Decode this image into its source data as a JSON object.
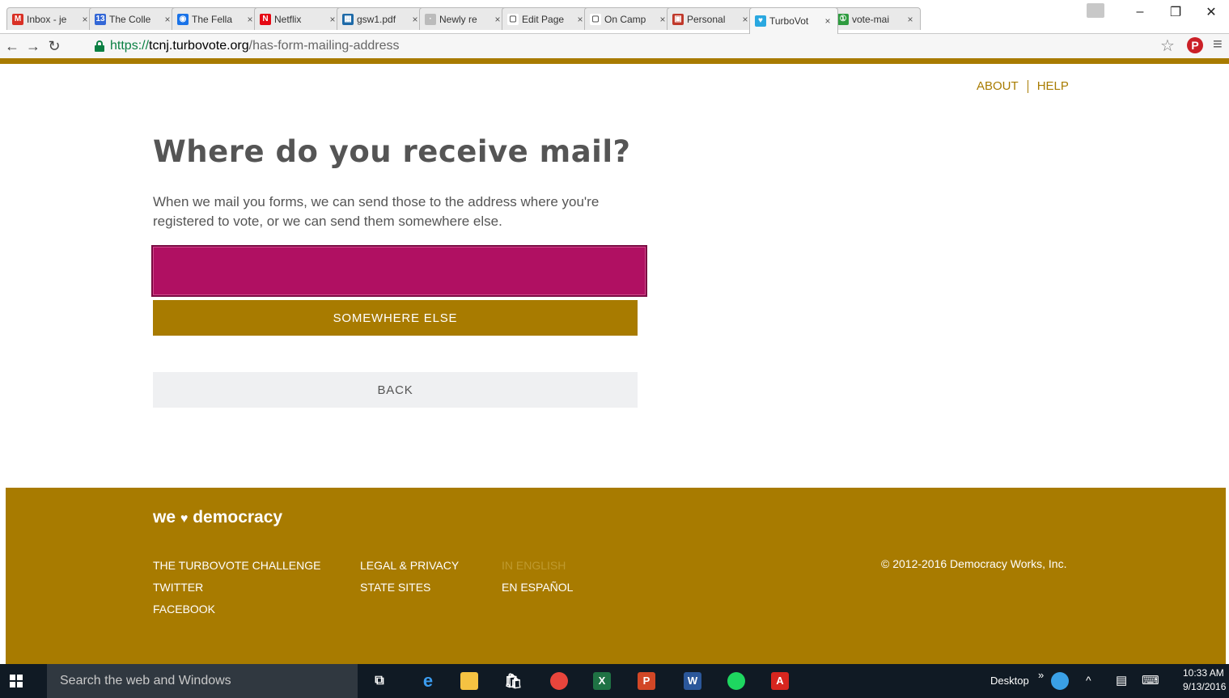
{
  "browser": {
    "tabs": [
      {
        "title": "Inbox - je",
        "favicon": "gmail-icon",
        "color": "#d93025",
        "glyph": "M"
      },
      {
        "title": "The Colle",
        "favicon": "calendar-icon",
        "color": "#3367d6",
        "glyph": "13"
      },
      {
        "title": "The Fella",
        "favicon": "circle-icon",
        "color": "#1a73e8",
        "glyph": "◉"
      },
      {
        "title": "Netflix",
        "favicon": "netflix-icon",
        "color": "#e50914",
        "glyph": "N"
      },
      {
        "title": "gsw1.pdf",
        "favicon": "sheet-icon",
        "color": "#1e6aa8",
        "glyph": "▦"
      },
      {
        "title": "Newly re",
        "favicon": "loading-icon",
        "color": "#bbbbbb",
        "glyph": "·"
      },
      {
        "title": "Edit Page",
        "favicon": "page-icon",
        "color": "#ffffff",
        "glyph": "▢"
      },
      {
        "title": "On Camp",
        "favicon": "page-icon",
        "color": "#ffffff",
        "glyph": "▢"
      },
      {
        "title": "Personal",
        "favicon": "personal-icon",
        "color": "#c0392b",
        "glyph": "▣"
      },
      {
        "title": "TurboVot",
        "favicon": "heart-icon",
        "color": "#2aa8e0",
        "glyph": "♥"
      },
      {
        "title": "vote-mai",
        "favicon": "vote-icon",
        "color": "#2e9b3f",
        "glyph": "①"
      }
    ],
    "url": {
      "scheme": "https://",
      "host": "tcnj.turbovote.org",
      "path": "/has-form-mailing-address"
    }
  },
  "header": {
    "about_label": "ABOUT",
    "help_label": "HELP"
  },
  "main": {
    "title": "Where do you receive mail?",
    "intro": "When we mail you forms, we can send those to the address where you're registered to vote, or we can send them somewhere else.",
    "registered_button_label": "",
    "somewhere_else_label": "SOMEWHERE ELSE",
    "back_label": "BACK"
  },
  "footer": {
    "brand_prefix": "we",
    "brand_suffix": "democracy",
    "col1": [
      "THE TURBOVOTE CHALLENGE",
      "TWITTER",
      "FACEBOOK"
    ],
    "col2": [
      "LEGAL & PRIVACY",
      "STATE SITES"
    ],
    "col3": [
      "IN ENGLISH",
      "EN ESPAÑOL"
    ],
    "copyright": "© 2012-2016 Democracy Works, Inc."
  },
  "taskbar": {
    "search_placeholder": "Search the web and Windows",
    "desktop_label": "Desktop",
    "time": "10:33 AM",
    "date": "9/13/2016"
  }
}
